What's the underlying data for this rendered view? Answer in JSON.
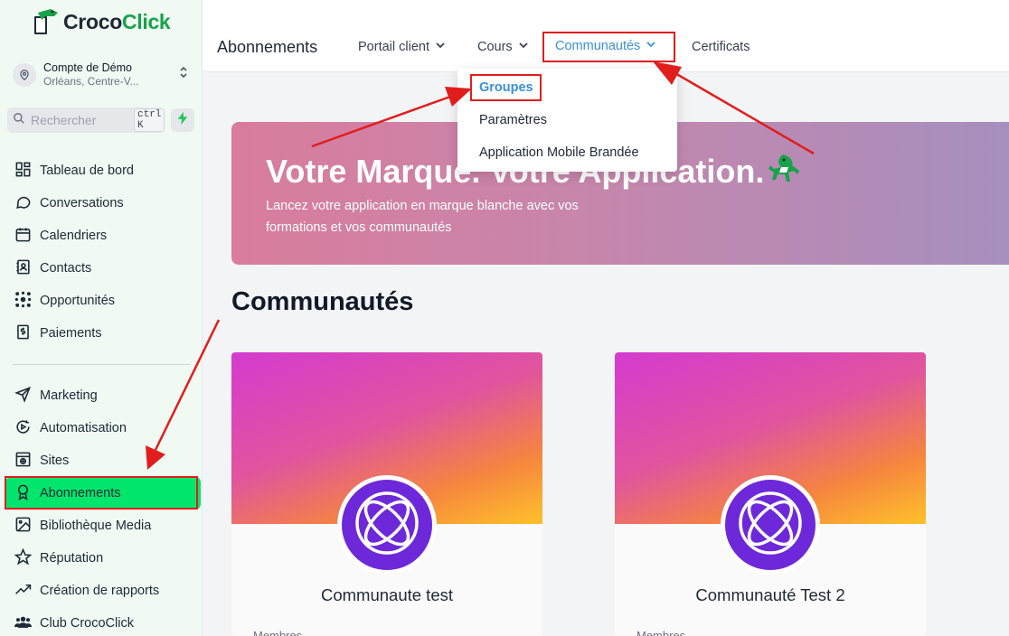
{
  "brand": {
    "name_part1": "Croco",
    "name_part2": "Click"
  },
  "account": {
    "name": "Compte de Démo",
    "location": "Orléans, Centre-V..."
  },
  "search": {
    "placeholder": "Rechercher",
    "shortcut": "ctrl K"
  },
  "sidebar": {
    "items": [
      {
        "label": "Tableau de bord",
        "icon": "dashboard-icon"
      },
      {
        "label": "Conversations",
        "icon": "chat-icon"
      },
      {
        "label": "Calendriers",
        "icon": "calendar-icon"
      },
      {
        "label": "Contacts",
        "icon": "contacts-icon"
      },
      {
        "label": "Opportunités",
        "icon": "opportunities-icon"
      },
      {
        "label": "Paiements",
        "icon": "payments-icon"
      },
      {
        "label": "Marketing",
        "icon": "send-icon"
      },
      {
        "label": "Automatisation",
        "icon": "automation-icon"
      },
      {
        "label": "Sites",
        "icon": "sites-icon"
      },
      {
        "label": "Abonnements",
        "icon": "award-icon",
        "active": true
      },
      {
        "label": "Bibliothèque Media",
        "icon": "image-icon"
      },
      {
        "label": "Réputation",
        "icon": "star-icon"
      },
      {
        "label": "Création de rapports",
        "icon": "trend-icon"
      },
      {
        "label": "Club CrocoClick",
        "icon": "users-icon"
      }
    ]
  },
  "header": {
    "title": "Abonnements",
    "tabs": [
      {
        "label": "Portail client",
        "has_dropdown": true
      },
      {
        "label": "Cours",
        "has_dropdown": true
      },
      {
        "label": "Communautés",
        "has_dropdown": true,
        "active": true
      },
      {
        "label": "Certificats",
        "has_dropdown": false
      }
    ]
  },
  "dropdown": {
    "items": [
      {
        "label": "Groupes",
        "active": true
      },
      {
        "label": "Paramètres"
      },
      {
        "label": "Application Mobile Brandée"
      }
    ]
  },
  "banner": {
    "title": "Votre Marque. Votre Application.",
    "subtitle": "Lancez votre application en marque blanche avec vos formations et vos communautés"
  },
  "main": {
    "section_title": "Communautés",
    "cards": [
      {
        "name": "Communaute test",
        "meta": "Membres"
      },
      {
        "name": "Communauté Test 2",
        "meta": "Membres"
      }
    ]
  },
  "colors": {
    "brand_green": "#16a34a",
    "active_nav": "#00e56b",
    "active_tab": "#3b8fd9",
    "annotation_red": "#e11d1d",
    "community_purple": "#6d28d9"
  }
}
